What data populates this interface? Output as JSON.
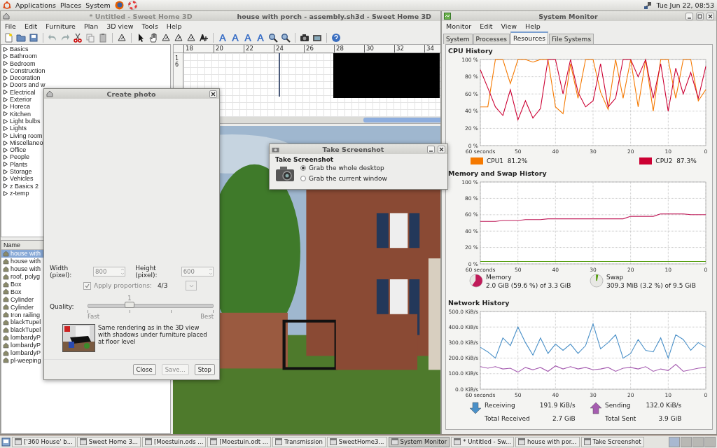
{
  "top_panel": {
    "menus": [
      "Applications",
      "Places",
      "System"
    ],
    "clock": "Tue Jun 22, 08:53"
  },
  "sweet_home": {
    "titles": [
      {
        "text": "* Untitled - Sweet Home 3D",
        "faded": true
      },
      {
        "text": "house with porch - assembly.sh3d - Sweet Home 3D",
        "faded": false
      }
    ],
    "menu": [
      "File",
      "Edit",
      "Furniture",
      "Plan",
      "3D view",
      "Tools",
      "Help"
    ],
    "catalog": [
      {
        "label": "Basics",
        "expanded": false
      },
      {
        "label": "Bathroom",
        "expanded": false
      },
      {
        "label": "Bedroom",
        "expanded": false
      },
      {
        "label": "Construction",
        "expanded": false
      },
      {
        "label": "Decoration",
        "expanded": false
      },
      {
        "label": "Doors and w",
        "expanded": false
      },
      {
        "label": "Electrical",
        "expanded": false
      },
      {
        "label": "Exterior",
        "expanded": false
      },
      {
        "label": "Horeca",
        "expanded": false
      },
      {
        "label": "Kitchen",
        "expanded": false
      },
      {
        "label": "Light bulbs",
        "expanded": false
      },
      {
        "label": "Lights",
        "expanded": false
      },
      {
        "label": "Living room",
        "expanded": false
      },
      {
        "label": "Miscellaneo",
        "expanded": false
      },
      {
        "label": "Office",
        "expanded": false
      },
      {
        "label": "People",
        "expanded": false
      },
      {
        "label": "Plants",
        "expanded": false
      },
      {
        "label": "Storage",
        "expanded": false
      },
      {
        "label": "Vehicles",
        "expanded": false
      },
      {
        "label": "z Basics 2",
        "expanded": false
      },
      {
        "label": "z-temp",
        "expanded": false
      }
    ],
    "furniture": {
      "columns": [
        "Name"
      ],
      "rows": [
        {
          "name": "house with",
          "selected": true
        },
        {
          "name": "house with",
          "selected": false
        },
        {
          "name": "house with",
          "selected": false
        },
        {
          "name": "roof, polyg",
          "selected": false
        },
        {
          "name": "Box",
          "selected": false
        },
        {
          "name": "Box",
          "selected": false
        },
        {
          "name": "Cylinder",
          "selected": false
        },
        {
          "name": "Cylinder",
          "selected": false
        },
        {
          "name": "Iron railing",
          "selected": false
        },
        {
          "name": "blackTupel",
          "selected": false
        },
        {
          "name": "blackTupel",
          "selected": false
        },
        {
          "name": "lombardyP",
          "selected": false
        },
        {
          "name": "lombardyP",
          "selected": false
        },
        {
          "name": "lombardyP",
          "selected": false
        },
        {
          "name": "pl-weeping",
          "selected": false
        }
      ]
    },
    "plan": {
      "x_ruler": [
        "18",
        "20",
        "22",
        "24",
        "26",
        "28",
        "30",
        "32",
        "34"
      ],
      "y_ruler": [
        "16"
      ]
    }
  },
  "create_photo": {
    "title": "Create photo",
    "width": {
      "label": "Width (pixel):",
      "value": "800",
      "disabled": true
    },
    "height": {
      "label": "Height (pixel):",
      "value": "600",
      "disabled": true
    },
    "proportions": {
      "label": "Apply proportions:",
      "checked": true,
      "disabled": true,
      "value": "4/3"
    },
    "quality": {
      "label": "Quality:",
      "value": "1",
      "level": 0.333,
      "ticks": [
        "Fast",
        "Best"
      ]
    },
    "description": "Same rendering as in the 3D view with shadows under furniture placed at floor level",
    "buttons": [
      {
        "label": "Close",
        "disabled": false
      },
      {
        "label": "Save...",
        "disabled": true
      },
      {
        "label": "Stop",
        "disabled": false
      }
    ]
  },
  "take_screenshot": {
    "title": "Take Screenshot",
    "heading": "Take Screenshot",
    "options": [
      {
        "label": "Grab the whole desktop",
        "selected": true
      },
      {
        "label": "Grab the current window",
        "selected": false
      }
    ]
  },
  "system_monitor": {
    "title": "System Monitor",
    "menu": [
      "Monitor",
      "Edit",
      "View",
      "Help"
    ],
    "tabs": [
      {
        "label": "System",
        "selected": false
      },
      {
        "label": "Processes",
        "selected": false
      },
      {
        "label": "Resources",
        "selected": true
      },
      {
        "label": "File Systems",
        "selected": false
      }
    ],
    "cpu": {
      "heading": "CPU History",
      "readings": [
        "81.2%",
        "87.3%"
      ],
      "chart_data": {
        "type": "line",
        "grid": true,
        "xlim": [
          60,
          0
        ],
        "ylim": [
          0,
          100
        ],
        "xticks": [
          {
            "value": 60,
            "label": "60 seconds"
          },
          50,
          40,
          30,
          20,
          10,
          0
        ],
        "yticks": [
          {
            "value": 0,
            "label": "0 %"
          },
          {
            "value": 20,
            "label": "20 %"
          },
          {
            "value": 40,
            "label": "40 %"
          },
          {
            "value": 60,
            "label": "60 %"
          },
          {
            "value": 80,
            "label": "80 %"
          },
          {
            "value": 100,
            "label": "100 %"
          }
        ],
        "x": [
          60,
          58,
          56,
          54,
          52,
          50,
          48,
          46,
          44,
          42,
          40,
          38,
          36,
          34,
          32,
          30,
          28,
          26,
          24,
          22,
          20,
          18,
          16,
          14,
          12,
          10,
          8,
          6,
          4,
          2,
          0
        ],
        "series": [
          {
            "name": "CPU1",
            "color": "#f57900",
            "values": [
              45,
              45,
              100,
              100,
              72,
              100,
              100,
              97,
              100,
              100,
              45,
              37,
              95,
              55,
              100,
              100,
              62,
              42,
              100,
              55,
              100,
              45,
              100,
              40,
              100,
              100,
              55,
              100,
              100,
              52,
              65
            ]
          },
          {
            "name": "CPU2",
            "color": "#cc0033",
            "values": [
              88,
              67,
              45,
              35,
              65,
              30,
              52,
              32,
              43,
              100,
              100,
              60,
              100,
              62,
              45,
              52,
              95,
              45,
              55,
              100,
              100,
              80,
              100,
              55,
              95,
              40,
              90,
              60,
              85,
              55,
              92
            ]
          }
        ]
      }
    },
    "memory": {
      "heading": "Memory and Swap History",
      "items": [
        {
          "detail": "2.0 GiB (59.6 %) of 3.3 GiB"
        },
        {
          "detail": "309.3 MiB (3.2 %) of 9.5 GiB"
        }
      ],
      "chart_data": {
        "type": "line",
        "grid": true,
        "xlim": [
          60,
          0
        ],
        "ylim": [
          0,
          100
        ],
        "xticks": [
          {
            "value": 60,
            "label": "60 seconds"
          },
          50,
          40,
          30,
          20,
          10,
          0
        ],
        "yticks": [
          {
            "value": 0,
            "label": "0 %"
          },
          {
            "value": 20,
            "label": "20 %"
          },
          {
            "value": 40,
            "label": "40 %"
          },
          {
            "value": 60,
            "label": "60 %"
          },
          {
            "value": 80,
            "label": "80 %"
          },
          {
            "value": 100,
            "label": "100 %"
          }
        ],
        "x": [
          60,
          58,
          56,
          54,
          52,
          50,
          48,
          46,
          44,
          42,
          40,
          38,
          36,
          34,
          32,
          30,
          28,
          26,
          24,
          22,
          20,
          18,
          16,
          14,
          12,
          10,
          8,
          6,
          4,
          2,
          0
        ],
        "series": [
          {
            "name": "Memory",
            "color": "#c01c5a",
            "values": [
              52,
              52,
              52,
              53,
              53,
              53,
              54,
              54,
              54,
              55,
              55,
              55,
              55,
              55,
              55,
              55,
              55,
              55,
              55,
              55,
              58,
              58,
              58,
              58,
              61,
              61,
              61,
              61,
              60,
              60,
              60
            ]
          },
          {
            "name": "Swap",
            "color": "#4e9a06",
            "values": [
              3,
              3,
              3,
              3,
              3,
              3,
              3,
              3,
              3,
              3,
              3,
              3,
              3,
              3,
              3,
              3,
              3,
              3,
              3,
              3,
              3,
              3,
              3,
              3,
              3,
              3,
              3,
              3,
              3,
              3,
              3
            ]
          }
        ]
      }
    },
    "network": {
      "heading": "Network History",
      "stats": [
        {
          "kind": "down",
          "rate": "191.9 KiB/s",
          "total_label": "Total Received",
          "total": "2.7 GiB"
        },
        {
          "kind": "up",
          "rate": "132.0 KiB/s",
          "total_label": "Total Sent",
          "total": "3.9 GiB"
        }
      ],
      "chart_data": {
        "type": "line",
        "grid": true,
        "xlim": [
          60,
          0
        ],
        "ylim": [
          0,
          500
        ],
        "xticks": [
          {
            "value": 60,
            "label": "60 seconds"
          },
          50,
          40,
          30,
          20,
          10,
          0
        ],
        "yticks": [
          {
            "value": 0,
            "label": "0.0 KiB/s"
          },
          {
            "value": 100,
            "label": "100.0 KiB/s"
          },
          {
            "value": 200,
            "label": "200.0 KiB/s"
          },
          {
            "value": 300,
            "label": "300.0 KiB/s"
          },
          {
            "value": 400,
            "label": "400.0 KiB/s"
          },
          {
            "value": 500,
            "label": "500.0 KiB/s"
          }
        ],
        "x": [
          60,
          58,
          56,
          54,
          52,
          50,
          48,
          46,
          44,
          42,
          40,
          38,
          36,
          34,
          32,
          30,
          28,
          26,
          24,
          22,
          20,
          18,
          16,
          14,
          12,
          10,
          8,
          6,
          4,
          2,
          0
        ],
        "series": [
          {
            "name": "Receiving",
            "color": "#4a90c8",
            "values": [
              270,
              240,
              200,
              330,
              280,
              400,
              300,
              220,
              330,
              230,
              290,
              250,
              290,
              230,
              280,
              420,
              260,
              300,
              350,
              200,
              230,
              320,
              250,
              240,
              330,
              200,
              350,
              320,
              250,
              300,
              270
            ]
          },
          {
            "name": "Sending",
            "color": "#a55cb0",
            "values": [
              145,
              135,
              145,
              130,
              135,
              110,
              140,
              125,
              140,
              115,
              150,
              130,
              145,
              130,
              140,
              125,
              130,
              140,
              115,
              135,
              140,
              130,
              145,
              115,
              130,
              120,
              160,
              115,
              125,
              135,
              140
            ]
          }
        ]
      }
    }
  },
  "taskbar": [
    {
      "label": "['360 House' b...",
      "selected": false
    },
    {
      "label": "Sweet Home 3...",
      "selected": false
    },
    {
      "label": "[Moestuin.ods ...",
      "selected": false
    },
    {
      "label": "[Moestuin.odt ...",
      "selected": false
    },
    {
      "label": "Transmission",
      "selected": false
    },
    {
      "label": "SweetHome3...",
      "selected": false
    },
    {
      "label": "System Monitor",
      "selected": true
    },
    {
      "label": "* Untitled - Sw...",
      "selected": false
    },
    {
      "label": "house with por...",
      "selected": false
    },
    {
      "label": "Take Screenshot",
      "selected": false
    }
  ]
}
